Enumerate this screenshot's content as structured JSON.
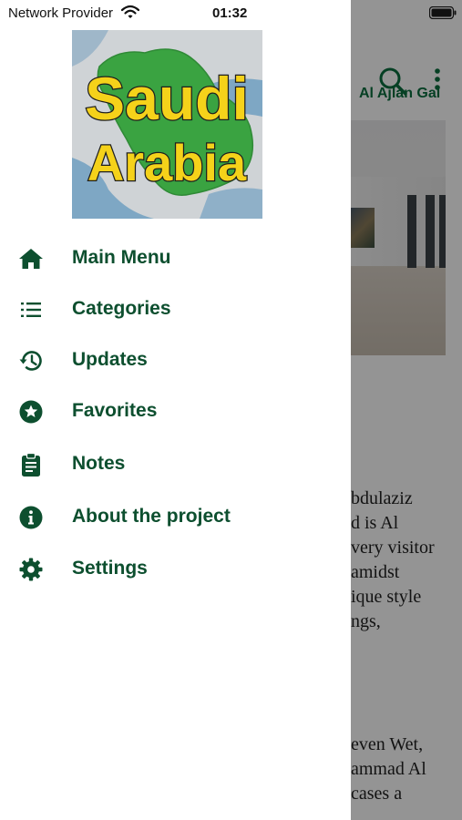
{
  "status_bar": {
    "carrier": "Network Provider",
    "time": "01:32"
  },
  "background_page": {
    "title": "Al Ajlan Gal",
    "body_lines_top": [
      "bdulaziz",
      "d is Al",
      "very visitor",
      "amidst",
      "ique style",
      "ngs,"
    ],
    "body_lines_bottom": [
      "even Wet,",
      "ammad Al",
      "cases a"
    ]
  },
  "logo": {
    "line1": "Saudi",
    "line2": "Arabia"
  },
  "menu": {
    "items": [
      {
        "label": "Main Menu",
        "icon": "home-icon"
      },
      {
        "label": "Categories",
        "icon": "list-icon"
      },
      {
        "label": "Updates",
        "icon": "history-icon"
      },
      {
        "label": "Favorites",
        "icon": "star-circle-icon"
      },
      {
        "label": "Notes",
        "icon": "clipboard-icon"
      },
      {
        "label": "About the project",
        "icon": "info-icon"
      },
      {
        "label": "Settings",
        "icon": "gear-icon"
      }
    ]
  },
  "colors": {
    "accent": "#0b6e3f",
    "menu_text": "#0d4f2f",
    "logo_land": "#3aa341",
    "logo_text": "#f5d21a"
  }
}
